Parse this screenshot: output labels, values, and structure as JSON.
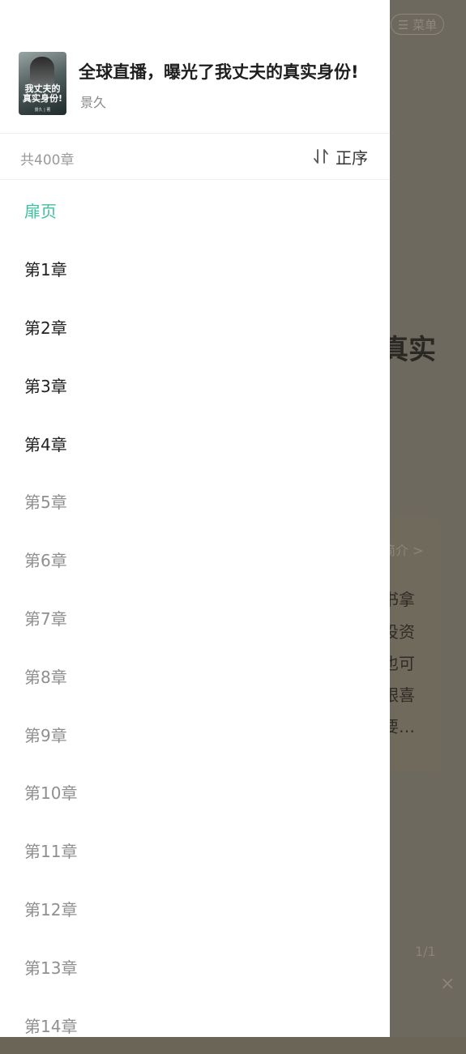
{
  "background": {
    "menu_label": "☰ 菜单",
    "title_fragment": "真实",
    "card_header": "简介 >",
    "card_lines": [
      "书拿",
      "投资",
      "也可",
      "跟喜",
      "要…"
    ],
    "page_indicator": "1/1",
    "close_glyph": "×"
  },
  "book": {
    "title": "全球直播，曝光了我丈夫的真实身份!",
    "author": "景久",
    "cover_text": "我丈夫的真实身份!",
    "cover_author": "景久 | 著"
  },
  "summary": {
    "chapter_count": "共400章",
    "sort_label": "正序"
  },
  "chapters": [
    {
      "label": "扉页",
      "state": "active"
    },
    {
      "label": "第1章",
      "state": "unlocked"
    },
    {
      "label": "第2章",
      "state": "unlocked"
    },
    {
      "label": "第3章",
      "state": "unlocked"
    },
    {
      "label": "第4章",
      "state": "unlocked"
    },
    {
      "label": "第5章",
      "state": "locked"
    },
    {
      "label": "第6章",
      "state": "locked"
    },
    {
      "label": "第7章",
      "state": "locked"
    },
    {
      "label": "第8章",
      "state": "locked"
    },
    {
      "label": "第9章",
      "state": "locked"
    },
    {
      "label": "第10章",
      "state": "locked"
    },
    {
      "label": "第11章",
      "state": "locked"
    },
    {
      "label": "第12章",
      "state": "locked"
    },
    {
      "label": "第13章",
      "state": "locked"
    },
    {
      "label": "第14章",
      "state": "locked"
    }
  ],
  "colors": {
    "accent": "#3cc19e",
    "unlocked_text": "#222222",
    "locked_text": "#8f8f8f",
    "overlay": "#6b6558"
  }
}
